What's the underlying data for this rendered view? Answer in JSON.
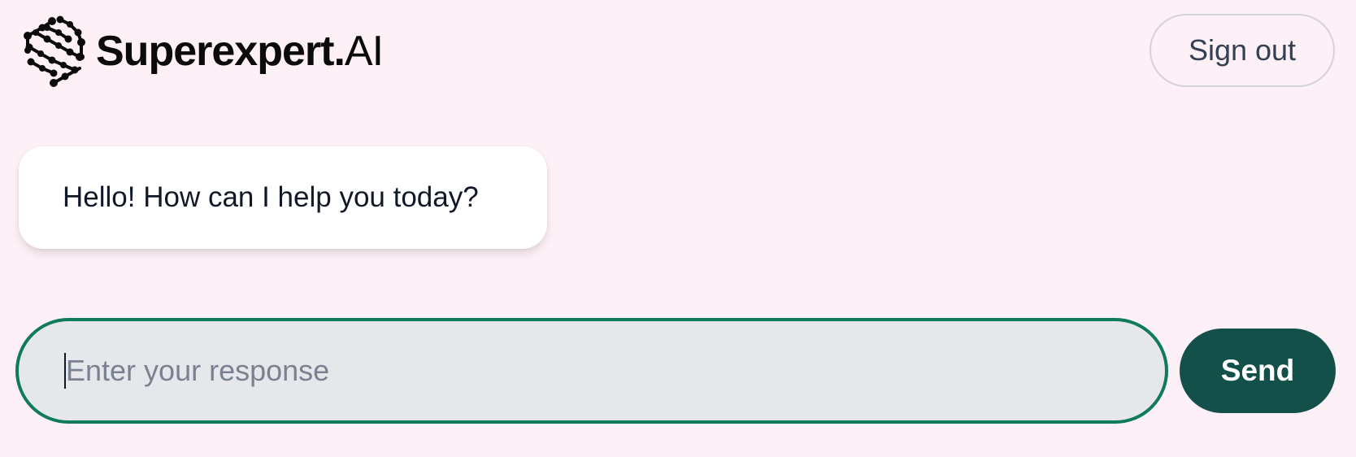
{
  "header": {
    "logo": {
      "icon": "hexagon-network-logo-icon",
      "name_bold": "Superexpert.",
      "name_light": "AI"
    },
    "signout_label": "Sign out"
  },
  "chat": {
    "messages": [
      {
        "role": "assistant",
        "text": "Hello! How can I help you today?"
      }
    ]
  },
  "composer": {
    "value": "",
    "placeholder": "Enter your response",
    "send_label": "Send"
  },
  "colors": {
    "background": "#fdf0f6",
    "send_button": "#135049",
    "input_border": "#0f7a5c",
    "input_fill": "#e5e7eb"
  }
}
